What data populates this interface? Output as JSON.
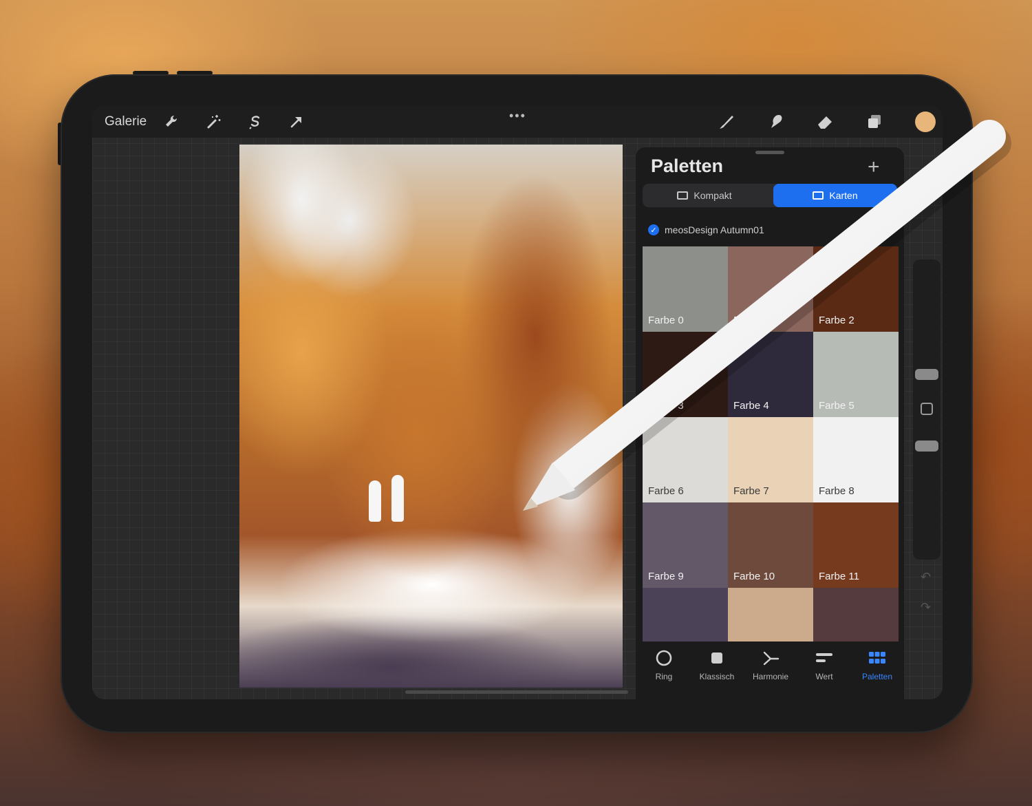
{
  "app": {
    "gallery_label": "Galerie",
    "more_dots": "•••"
  },
  "toolbar": {
    "left_icons": [
      "wrench-icon",
      "magic-wand-icon",
      "selection-icon",
      "move-arrow-icon"
    ],
    "right_icons": [
      "brush-icon",
      "smudge-icon",
      "eraser-icon",
      "layers-icon"
    ],
    "current_color": "#e8b57a"
  },
  "palette_panel": {
    "title": "Paletten",
    "add_label": "+",
    "view_modes": [
      {
        "label": "Kompakt",
        "active": false
      },
      {
        "label": "Karten",
        "active": true
      }
    ],
    "palette_name": "meosDesign Autumn01",
    "swatches": [
      {
        "label": "Farbe 0",
        "color": "#8c8f8a"
      },
      {
        "label": "Farbe 1",
        "color": "#8a665d"
      },
      {
        "label": "Farbe 2",
        "color": "#5a2a14"
      },
      {
        "label": "Farbe 3",
        "color": "#2e1a14"
      },
      {
        "label": "Farbe 4",
        "color": "#2f2a3b"
      },
      {
        "label": "Farbe 5",
        "color": "#b7bbb6"
      },
      {
        "label": "Farbe 6",
        "color": "#dcdbd7"
      },
      {
        "label": "Farbe 7",
        "color": "#ead2b6"
      },
      {
        "label": "Farbe 8",
        "color": "#f1f1f1"
      },
      {
        "label": "Farbe 9",
        "color": "#625868"
      },
      {
        "label": "Farbe 10",
        "color": "#6e4a3c"
      },
      {
        "label": "Farbe 11",
        "color": "#763a1e"
      },
      {
        "label": "",
        "color": "#4c4258"
      },
      {
        "label": "",
        "color": "#ccab8c"
      },
      {
        "label": "",
        "color": "#553b3e"
      }
    ],
    "bottom_tabs": [
      {
        "label": "Ring",
        "icon": "ring-icon",
        "active": false
      },
      {
        "label": "Klassisch",
        "icon": "square-icon",
        "active": false
      },
      {
        "label": "Harmonie",
        "icon": "harmony-icon",
        "active": false
      },
      {
        "label": "Wert",
        "icon": "sliders-icon",
        "active": false
      },
      {
        "label": "Paletten",
        "icon": "grid-icon",
        "active": true
      }
    ]
  },
  "sidebar": {
    "undo_glyph": "↶",
    "redo_glyph": "↷"
  },
  "colors": {
    "accent": "#1e6ff0"
  }
}
